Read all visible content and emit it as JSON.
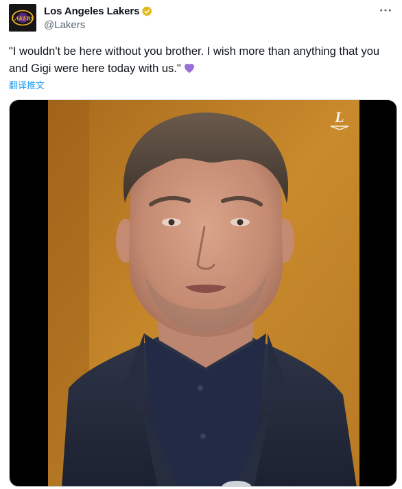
{
  "author": {
    "display_name": "Los Angeles Lakers",
    "handle": "@Lakers",
    "avatar_text": "LAKERS",
    "verified_badge_color": "#e2b719"
  },
  "tweet": {
    "text": "\"I wouldn't be here without you brother. I wish more than anything that you and Gigi were here today with us.\"",
    "emoji": "purple-heart",
    "emoji_color": "#9b6fd6",
    "translate_label": "翻译推文"
  },
  "media": {
    "watermark_text": "L"
  },
  "icons": {
    "more": "more-options-icon",
    "verified": "verified-badge-icon"
  },
  "colors": {
    "link": "#1d9bf0",
    "secondary_text": "#536471",
    "brand_gold": "#fdb927",
    "brand_purple": "#552583"
  }
}
